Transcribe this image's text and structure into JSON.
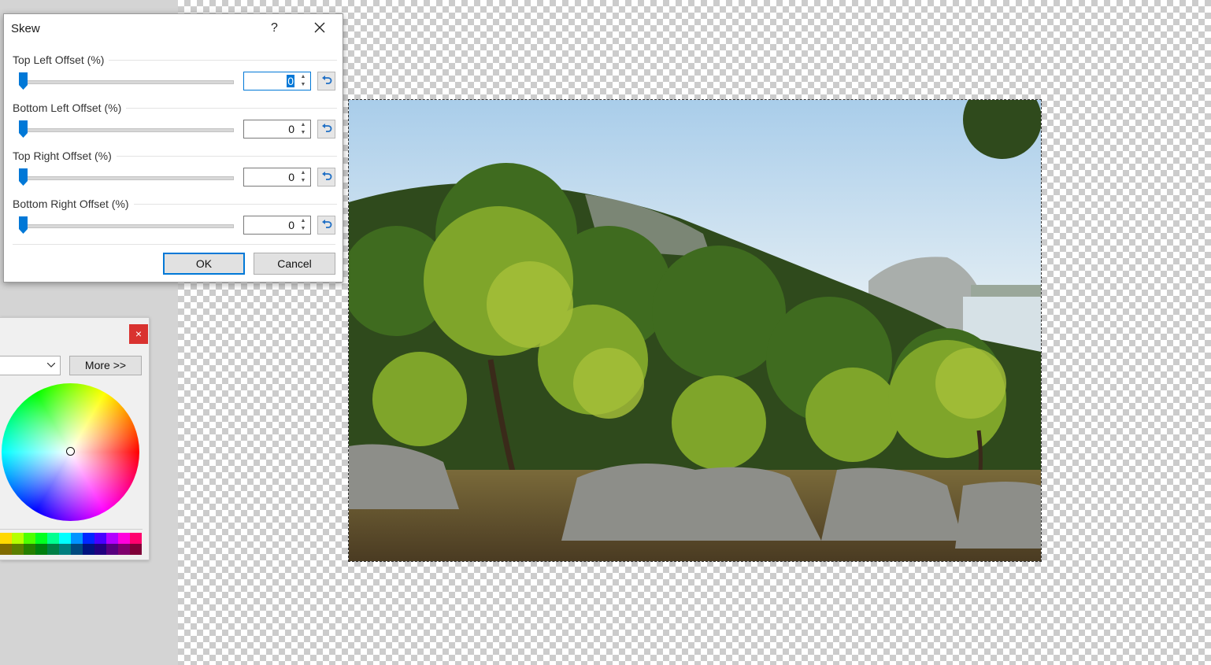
{
  "dialog": {
    "title": "Skew",
    "help_label": "?",
    "sections": [
      {
        "label": "Top Left Offset (%)",
        "value": "0",
        "slider": 0
      },
      {
        "label": "Bottom Left Offset (%)",
        "value": "0",
        "slider": 0
      },
      {
        "label": "Top Right Offset (%)",
        "value": "0",
        "slider": 0
      },
      {
        "label": "Bottom Right Offset (%)",
        "value": "0",
        "slider": 0
      }
    ],
    "ok_label": "OK",
    "cancel_label": "Cancel"
  },
  "colors_panel": {
    "close_label": "×",
    "mode_value": "",
    "more_label": "More >>",
    "palette_top": [
      "#ffd800",
      "#b6ff00",
      "#4cff00",
      "#00ff21",
      "#00ff90",
      "#00ffff",
      "#0094ff",
      "#0026ff",
      "#4800ff",
      "#b200ff",
      "#ff00dc",
      "#ff006e"
    ],
    "palette_bottom": [
      "#7f6a00",
      "#5b7f00",
      "#267f00",
      "#007f0e",
      "#007f46",
      "#007f7f",
      "#004a7f",
      "#00137f",
      "#21007f",
      "#57007f",
      "#7f006e",
      "#7f0037"
    ]
  },
  "canvas": {
    "image_description_icon": "landscape-photo"
  }
}
